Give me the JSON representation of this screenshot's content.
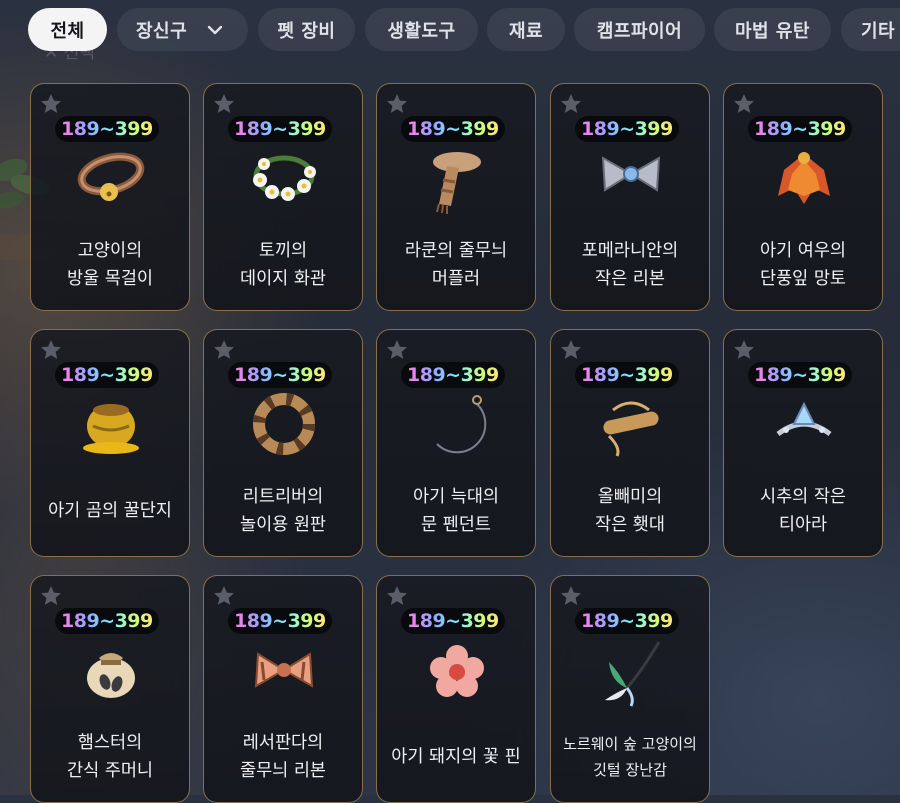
{
  "filters": [
    {
      "label": "전체",
      "active": true
    },
    {
      "label": "장신구",
      "active": false
    },
    {
      "label": "펫 장비",
      "active": false
    },
    {
      "label": "생활도구",
      "active": false
    },
    {
      "label": "재료",
      "active": false
    },
    {
      "label": "캠프파이어",
      "active": false
    },
    {
      "label": "마법 유탄",
      "active": false
    },
    {
      "label": "기타",
      "active": false
    }
  ],
  "items": [
    {
      "level": "189~399",
      "name": "고양이의\n방울 목걸이",
      "icon": "bell-collar-icon"
    },
    {
      "level": "189~399",
      "name": "토끼의\n데이지 화관",
      "icon": "daisy-wreath-icon"
    },
    {
      "level": "189~399",
      "name": "라쿤의 줄무늬\n머플러",
      "icon": "striped-muffler-icon"
    },
    {
      "level": "189~399",
      "name": "포메라니안의\n작은 리본",
      "icon": "small-ribbon-icon"
    },
    {
      "level": "189~399",
      "name": "아기 여우의\n단풍잎 망토",
      "icon": "maple-cloak-icon"
    },
    {
      "level": "189~399",
      "name": "아기 곰의 꿀단지",
      "icon": "honey-pot-icon"
    },
    {
      "level": "189~399",
      "name": "리트리버의\n놀이용 원판",
      "icon": "play-ring-icon"
    },
    {
      "level": "189~399",
      "name": "아기 늑대의\n문 펜던트",
      "icon": "moon-pendant-icon"
    },
    {
      "level": "189~399",
      "name": "올빼미의\n작은 횃대",
      "icon": "perch-icon"
    },
    {
      "level": "189~399",
      "name": "시추의 작은\n티아라",
      "icon": "tiara-icon"
    },
    {
      "level": "189~399",
      "name": "햄스터의\n간식 주머니",
      "icon": "snack-pouch-icon"
    },
    {
      "level": "189~399",
      "name": "레서판다의\n줄무늬 리본",
      "icon": "striped-ribbon-icon"
    },
    {
      "level": "189~399",
      "name": "아기 돼지의 꽃 핀",
      "icon": "flower-pin-icon"
    },
    {
      "level": "189~399",
      "name": "노르웨이 숲 고양이의\n깃털 장난감",
      "icon": "feather-toy-icon"
    }
  ],
  "colors": {
    "card_border": "#af8c58",
    "chip_bg": "#3a404e",
    "chip_active_bg": "#f4f4f5"
  }
}
